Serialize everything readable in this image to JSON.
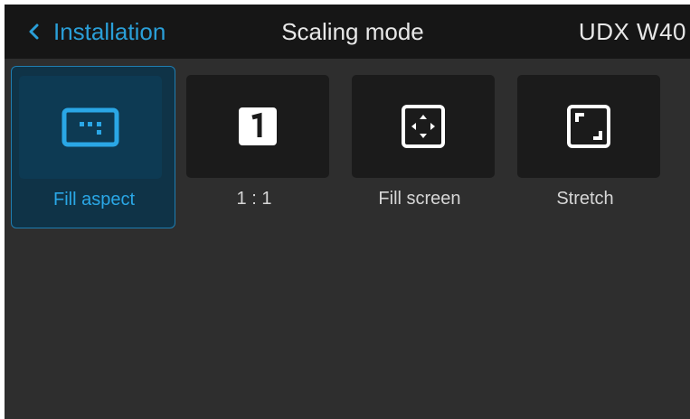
{
  "header": {
    "back_label": "Installation",
    "title": "Scaling mode",
    "device": "UDX W40"
  },
  "options": [
    {
      "label": "Fill aspect",
      "icon": "fill-aspect-icon",
      "selected": true
    },
    {
      "label": "1 : 1",
      "icon": "one-to-one-icon",
      "selected": false
    },
    {
      "label": "Fill screen",
      "icon": "fill-screen-icon",
      "selected": false
    },
    {
      "label": "Stretch",
      "icon": "stretch-icon",
      "selected": false
    }
  ],
  "colors": {
    "accent": "#2a9fd8",
    "background": "#2e2e2e",
    "header": "#161616",
    "tile": "#1b1b1b",
    "selected_tile": "#0f3347"
  }
}
